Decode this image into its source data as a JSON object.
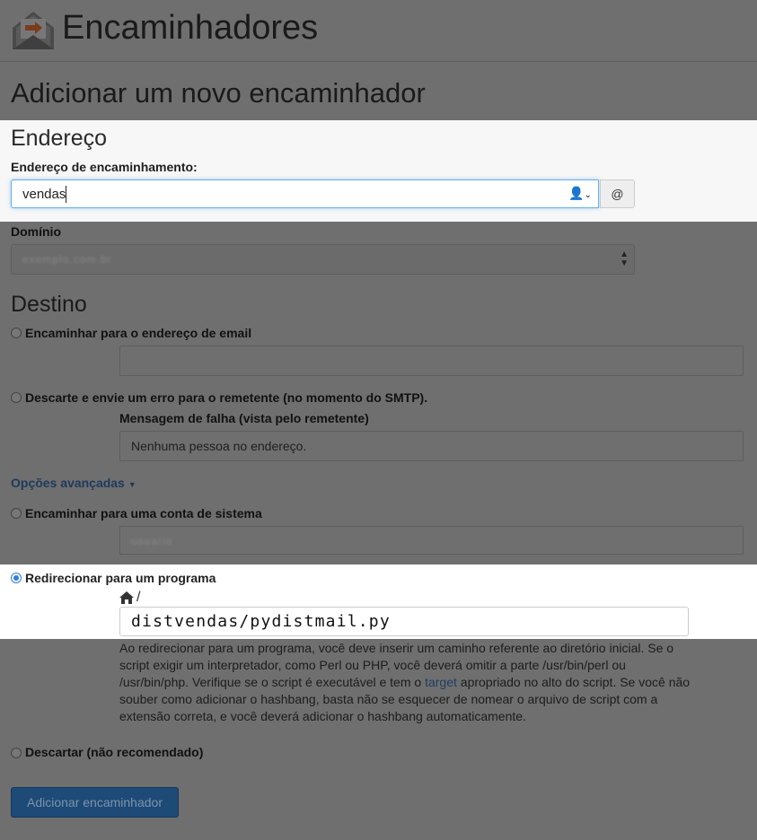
{
  "header": {
    "title": "Encaminhadores",
    "icon": "forwarder-envelope-icon"
  },
  "page_title": "Adicionar um novo encaminhador",
  "address": {
    "heading": "Endereço",
    "forward_label": "Endereço de encaminhamento:",
    "forward_value": "vendas",
    "at_symbol": "@",
    "domain_label": "Domínio",
    "domain_value": "exemplo.com.br"
  },
  "destination": {
    "heading": "Destino",
    "options": {
      "forward_email": "Encaminhar para o endereço de email",
      "discard_error": "Descarte e envie um erro para o remetente (no momento do SMTP).",
      "failure_label": "Mensagem de falha (vista pelo remetente)",
      "failure_value": "Nenhuma pessoa no endereço.",
      "advanced": "Opções avançadas",
      "system_account": "Encaminhar para uma conta de sistema",
      "system_account_value": "usuario",
      "pipe": "Redirecionar para um programa",
      "pipe_path_prefix": "/",
      "pipe_value": "distvendas/pydistmail.py",
      "discard": "Descartar (não recomendado)"
    },
    "selected": "pipe",
    "help_part1": "Ao redirecionar para um programa, você deve inserir um caminho referente ao diretório inicial. Se o script exigir um interpretador, como Perl ou PHP, você deverá omitir a parte /usr/bin/perl ou /usr/bin/php. Verifique se o script é executável e tem o ",
    "help_link": "target",
    "help_part2": " apropriado no alto do script. Se você não souber como adicionar o hashbang, basta não se esquecer de nomear o arquivo de script com a extensão correta, e você deverá adicionar o hashbang automaticamente."
  },
  "submit_label": "Adicionar encaminhador",
  "colors": {
    "accent": "#66afe9",
    "radio_selected": "#2d7ee8",
    "button": "#1d4a76",
    "overlay": "#6f6f6f"
  }
}
